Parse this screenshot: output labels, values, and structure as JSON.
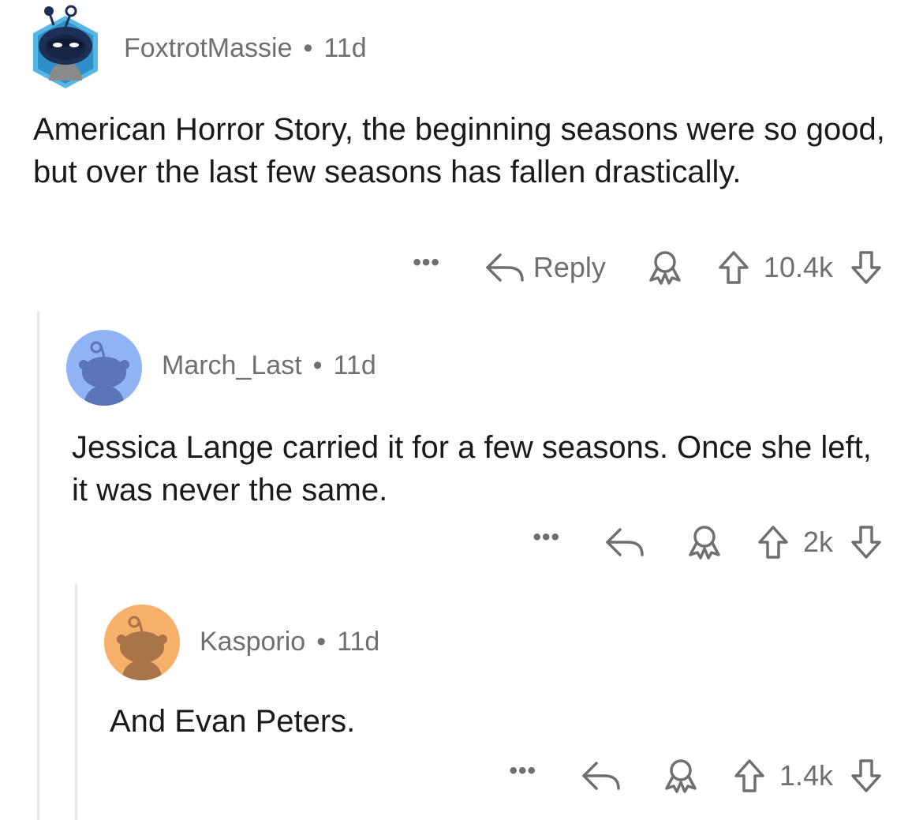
{
  "comments": [
    {
      "username": "FoxtrotMassie",
      "age": "11d",
      "body": "American Horror Story, the beginning seasons were so good, but over the last few seasons has fallen drastically.",
      "reply_label": "Reply",
      "score": "10.4k",
      "avatar": "snoo-hexagon-nft-avatar"
    },
    {
      "username": "March_Last",
      "age": "11d",
      "body": "Jessica Lange carried it for a few seasons. Once she left, it was never the same.",
      "score": "2k",
      "avatar_color": "#8fb3f5"
    },
    {
      "username": "Kasporio",
      "age": "11d",
      "body": "And Evan Peters.",
      "score": "1.4k",
      "avatar_color": "#f7b06a"
    }
  ],
  "meta_separator": "•",
  "more_label": "•••",
  "colors": {
    "meta_text": "#6f6f6f",
    "thread_line": "#e6e6e6",
    "body_text": "#1a1a1b"
  }
}
